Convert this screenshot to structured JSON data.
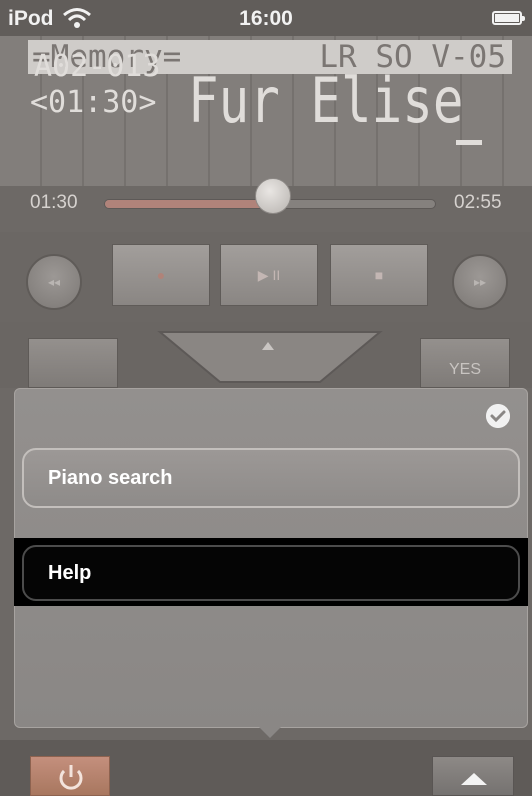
{
  "status_bar": {
    "carrier": "iPod",
    "time": "16:00",
    "wifi_icon": "wifi-icon",
    "battery_icon": "battery-full-icon"
  },
  "lcd": {
    "mode": "=Memory=",
    "version": "LR SO V-05",
    "track": "A02-013",
    "time": "<01:30>",
    "title": "Fur Elise"
  },
  "progress": {
    "elapsed": "01:30",
    "total": "02:55",
    "fraction": 0.51
  },
  "transport": {
    "rewind_label": "◂◂",
    "record_label": "●",
    "play_pause_label": "▶ II",
    "stop_label": "■",
    "fast_forward_label": "▸▸"
  },
  "controls": {
    "yes_label": "YES"
  },
  "popup": {
    "confirm_icon": "checkmark-icon",
    "options": [
      {
        "label": "Piano search"
      },
      {
        "label": "Help"
      }
    ]
  },
  "bottom_bar": {
    "power_icon": "power-icon",
    "up_icon": "triangle-up-icon"
  },
  "colors": {
    "accent_power": "#c48f7d",
    "selected_option_bg": "#000000",
    "lcd_text": "#e0ddda"
  }
}
